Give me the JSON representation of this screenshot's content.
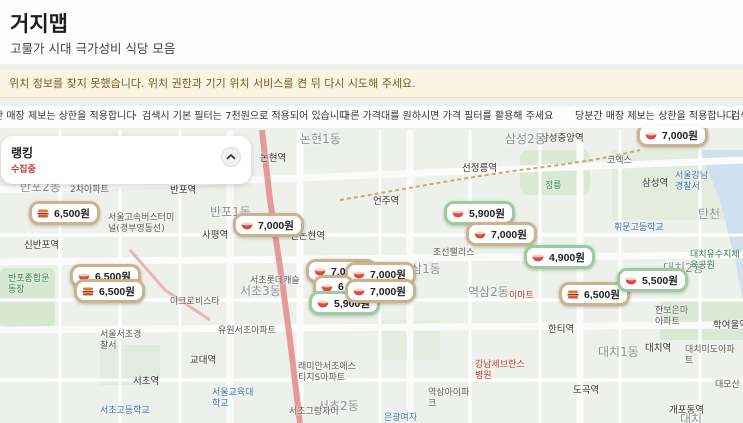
{
  "app": {
    "title": "거지맵",
    "subtitle": "고물가 시대 극가성비 식당 모음"
  },
  "alerts": {
    "location_error": "위치 정보를 찾지 못했습니다. 위치 권한과 기기 위치 서비스를 켠 뒤 다시 시도해 주세요."
  },
  "ticker": {
    "items": [
      "간 매장 제보는 상한을 적용합니다",
      "검색시 기본 필터는 7천원으로 적용되어 있습니다",
      "다른 가격대를 원하시면 가격 필터를 활용해 주세요",
      "당분간 매장 제보는 상한을 적용합니다",
      "검색"
    ],
    "separator": "·"
  },
  "ranking": {
    "title": "랭킹",
    "status": "수집중"
  },
  "markers": [
    {
      "price": "6,500원",
      "style": "tan",
      "icon": "burger-icon"
    },
    {
      "price": "7,000원",
      "style": "tan",
      "icon": "bowl-icon"
    },
    {
      "price": "6,500원",
      "style": "tan",
      "icon": "bowl-icon"
    },
    {
      "price": "6,500원",
      "style": "tan",
      "icon": "burger-icon"
    },
    {
      "price": "7,000원",
      "style": "tan",
      "icon": "bowl-icon"
    },
    {
      "price": "7,000원",
      "style": "tan",
      "icon": "bowl-icon"
    },
    {
      "price": "6",
      "style": "tan",
      "icon": "bowl-icon"
    },
    {
      "price": "5,900원",
      "style": "green",
      "icon": "bowl-icon"
    },
    {
      "price": "7,000원",
      "style": "tan",
      "icon": "bowl-icon"
    },
    {
      "price": "5,900원",
      "style": "green",
      "icon": "bowl-icon"
    },
    {
      "price": "7,000원",
      "style": "tan",
      "icon": "bowl-icon"
    },
    {
      "price": "4,900원",
      "style": "green",
      "icon": "bowl-icon"
    },
    {
      "price": "6,500원",
      "style": "tan",
      "icon": "burger-icon"
    },
    {
      "price": "5,500원",
      "style": "green",
      "icon": "bowl-icon"
    },
    {
      "price": "7,000원",
      "style": "tan",
      "icon": "bowl-icon"
    }
  ],
  "map_labels": [
    "반포2동",
    "2차아파트",
    "반포역",
    "신반포역",
    "반포종합운동장",
    "서울고속버스터미널(경부영동선)",
    "사평역",
    "반포1동",
    "서초롯데캐슬",
    "서초3동",
    "아크로비스타",
    "유원서초아파트",
    "서울서초경찰서",
    "교대역",
    "서초역",
    "서초고등학교",
    "래미안서초에스티지S아파트",
    "서초2동",
    "서초그랑자이",
    "서울교육대학교",
    "논현역",
    "논현1동",
    "신논현역",
    "언주역",
    "선정릉역",
    "삼성중앙역",
    "삼성2동",
    "정릉",
    "조선팰리스",
    "역삼1동",
    "역삼2동",
    "이마트",
    "강남세브란스병원",
    "역삼아이파크",
    "한티역",
    "대치1동",
    "도곡역",
    "대치역",
    "개포동역",
    "대치미도아파트",
    "대모산",
    "학여울역",
    "탄천",
    "삼성역",
    "코엑스",
    "서울강남경찰서",
    "휘문고등학교",
    "대치2동",
    "한보은마아파트",
    "대치유수지체육공원",
    "은광여자",
    "대치"
  ]
}
